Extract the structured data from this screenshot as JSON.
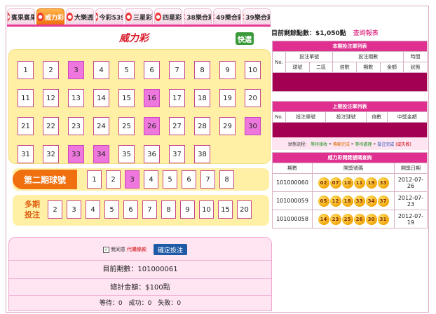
{
  "tabs": [
    {
      "label": "賓果賓果",
      "icon": "bingo-icon",
      "active": false
    },
    {
      "label": "威力彩",
      "icon": "powerball-icon",
      "active": true
    },
    {
      "label": "大樂透",
      "icon": "lotto-icon",
      "active": false
    },
    {
      "label": "今彩539",
      "icon": "539-icon",
      "active": false
    },
    {
      "label": "三星彩",
      "icon": "3star-icon",
      "active": false
    },
    {
      "label": "四星彩",
      "icon": "4star-icon",
      "active": false
    },
    {
      "label": "38樂合彩",
      "icon": "38-icon",
      "active": false
    },
    {
      "label": "49樂合彩",
      "icon": "49-icon",
      "active": false
    },
    {
      "label": "39樂合彩",
      "icon": "39-icon",
      "active": false
    }
  ],
  "logo_text": "威力彩",
  "quick_label": "快選",
  "first_area": {
    "numbers": [
      "1",
      "2",
      "3",
      "4",
      "5",
      "6",
      "7",
      "8",
      "9",
      "10",
      "11",
      "12",
      "13",
      "14",
      "15",
      "16",
      "17",
      "18",
      "19",
      "20",
      "21",
      "22",
      "23",
      "24",
      "25",
      "26",
      "27",
      "28",
      "29",
      "30",
      "31",
      "32",
      "33",
      "34",
      "35",
      "36",
      "37",
      "38"
    ],
    "selected": [
      "3",
      "16",
      "26",
      "30",
      "33",
      "34"
    ]
  },
  "second_area": {
    "label": "第二期球號",
    "numbers": [
      "1",
      "2",
      "3",
      "4",
      "5",
      "6",
      "7",
      "8"
    ],
    "selected": [
      "3"
    ]
  },
  "multi_period": {
    "label_line1": "多期",
    "label_line2": "投注",
    "options": [
      "2",
      "3",
      "4",
      "5",
      "6",
      "7",
      "8",
      "9",
      "10",
      "15",
      "20"
    ]
  },
  "bottom": {
    "agree_prefix": "我同意",
    "agree_link": "代購條款",
    "confirm_label": "確定投注",
    "period_text": "目前期數：101000061",
    "total_text": "總計金額：$100點",
    "status_text": "等待：0　成功：0　失敗：0"
  },
  "account": {
    "points_text": "目前剩餘點數：$1,050點",
    "report_link": "查詢報表"
  },
  "current_bets": {
    "title": "本期投注單列表",
    "header_row1": [
      "No.",
      "投注單號",
      "投注期數",
      "時間"
    ],
    "header_row2": [
      "球號",
      "二區",
      "倍數",
      "期數",
      "金額",
      "狀態"
    ]
  },
  "last_bets": {
    "title": "上期投注單列表",
    "headers": [
      "No.",
      "投注單號",
      "投注球號",
      "倍數",
      "中獎金額"
    ]
  },
  "status_flow": {
    "prefix": "狀態流程：",
    "steps": [
      "等待接收",
      "傳輸完成",
      "等待處理",
      "投注完成"
    ],
    "fail": "(或失敗)"
  },
  "history": {
    "title": "威力彩開獎號碼查詢",
    "headers": [
      "期數",
      "開獎號碼",
      "開獎日期"
    ],
    "rows": [
      {
        "period": "101000060",
        "balls": [
          "02",
          "07",
          "10",
          "11",
          "19",
          "33"
        ],
        "date": "2012-07-26"
      },
      {
        "period": "101000059",
        "balls": [
          "05",
          "12",
          "18",
          "33",
          "34",
          "37"
        ],
        "date": "2012-07-23"
      },
      {
        "period": "101000058",
        "balls": [
          "14",
          "23",
          "25",
          "26",
          "30",
          "31"
        ],
        "date": "2012-07-19"
      }
    ]
  }
}
